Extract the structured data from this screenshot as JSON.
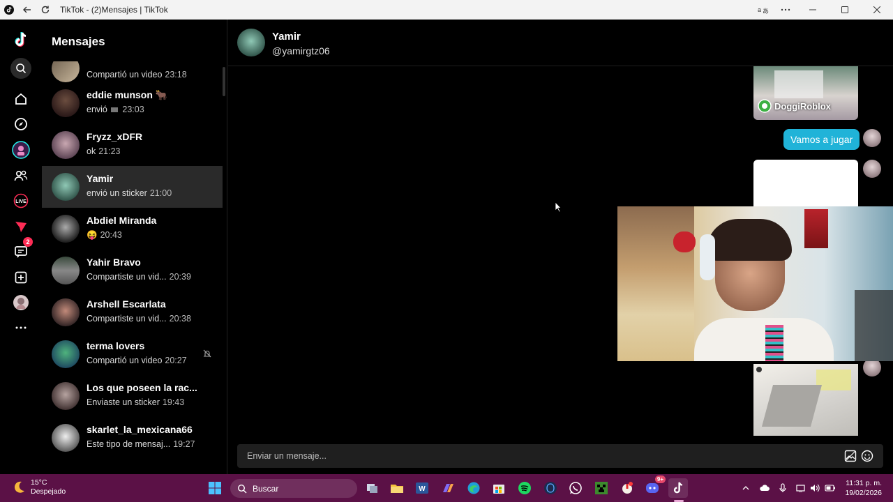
{
  "window": {
    "title": "TikTok - (2)Mensajes | TikTok"
  },
  "rail": {
    "notifications_badge": "2"
  },
  "conversations": {
    "header": "Mensajes",
    "items": [
      {
        "name": "",
        "preview": "Compartió un video",
        "time": "23:18"
      },
      {
        "name": "eddie munson 🐂",
        "preview": "envió",
        "time": "23:03"
      },
      {
        "name": "Fryzz_xDFR",
        "preview": "ok",
        "time": "21:23"
      },
      {
        "name": "Yamir",
        "preview": "envió un sticker",
        "time": "21:00"
      },
      {
        "name": "Abdiel Miranda",
        "preview": "😝",
        "time": "20:43"
      },
      {
        "name": "Yahir Bravo",
        "preview": "Compartiste un vid...",
        "time": "20:39"
      },
      {
        "name": "Arshell Escarlata",
        "preview": "Compartiste un vid...",
        "time": "20:38"
      },
      {
        "name": "terma lovers",
        "preview": "Compartió un video",
        "time": "20:27"
      },
      {
        "name": "Los que poseen la rac...",
        "preview": "Enviaste un sticker",
        "time": "19:43"
      },
      {
        "name": "skarlet_la_mexicana66",
        "preview": "Este tipo de mensaj...",
        "time": "19:27"
      }
    ]
  },
  "chat": {
    "name": "Yamir",
    "handle": "@yamirgtz06",
    "shared_video_author": "DoggiRoblox",
    "message": "Vamos a jugar",
    "input_placeholder": "Enviar un mensaje..."
  },
  "taskbar": {
    "temperature": "15°C",
    "weather": "Despejado",
    "search_label": "Buscar",
    "time": "11:31 p. m.",
    "date": "19/02/2026",
    "discord_badge": "9+"
  },
  "colors": {
    "accent": "#20b3d8",
    "tiktok_red": "#fe2c55",
    "taskbar": "#5b1146"
  }
}
